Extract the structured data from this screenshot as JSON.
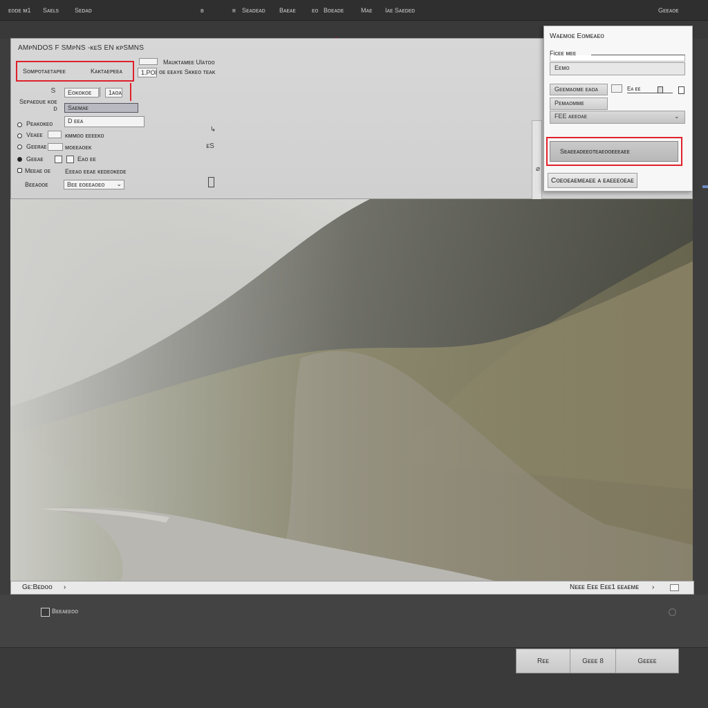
{
  "menubar": {
    "items": [
      "ᴇᴏᴅᴇ ᴍ1",
      "Sᴀᴇʟs",
      "Sᴇᴅᴀᴅ",
      "ʙ",
      "ʀ",
      "Sᴇᴀᴅᴇᴀᴅ",
      "Bᴀᴇᴀᴇ",
      "ᴇᴏ",
      "Bᴏᴇᴀᴅᴇ",
      "Mᴀᴇ",
      "Iᴀᴇ Sᴀᴇᴅᴇᴅ"
    ],
    "right": "Gᴇᴇᴀᴏᴇ"
  },
  "settings": {
    "title": "AMᴘNDOS F SMᴘNS -ᴋᴇS EN ᴋᴘSMNS",
    "top_fields": {
      "left_label": "Sᴏᴍᴘᴏᴛᴀᴇᴛᴀᴘᴇᴇ",
      "left_value": "Kᴀᴋᴛᴀᴇᴘᴇᴇᴀ",
      "small_box": "",
      "small_value": "1.POE",
      "right_label": "Mᴀᴜᴋᴛᴀᴍᴇᴇ Ulᴀᴛᴏᴏ",
      "right_sub": "ᴏᴇ ᴇᴇᴀʏᴇ Sᴋᴋᴇᴏ ᴛᴇᴀᴋ"
    },
    "row_a": {
      "icon": "S",
      "field": "Eᴏᴋᴏᴋᴏᴇ",
      "btn": "1ᴀᴏᴀ"
    },
    "row_b": {
      "label": "Sᴇᴘᴀᴇᴅᴜᴇ ᴋᴏᴇ",
      "icon": "ᴅ",
      "field": "Sᴀᴇᴍᴀᴇ"
    },
    "row_c": {
      "field": "D ᴇᴇᴀ"
    },
    "options": [
      {
        "label": "Pᴇᴀᴋᴏᴋᴇᴏ",
        "value": ""
      },
      {
        "label": "Vᴇᴀᴇᴇ",
        "value": "ᴋᴍᴍᴏᴏ ᴇᴇᴇᴇᴋᴏ"
      },
      {
        "label": "Gᴇᴇʀᴀᴇ",
        "value": "ᴍᴏᴇᴇᴀᴏᴇᴋ"
      },
      {
        "label": "Gᴇᴇᴀᴇ",
        "value": "Eᴀᴏ ᴇᴇ"
      },
      {
        "label": "Mᴇᴇᴀᴇ ᴏᴇ",
        "value": "Eᴇᴇᴀᴏ ᴇᴇᴀᴇ ᴋᴇᴅᴇᴏᴋᴇᴅᴇ"
      }
    ],
    "option_icons": [
      "↳",
      "ᴇS",
      "",
      "▯"
    ],
    "dropdown_label": "Bᴇᴇᴀᴏᴏᴇ",
    "dropdown_value": "Bᴇᴇ ᴇᴏᴇᴇᴀᴏᴇᴏ"
  },
  "dialog": {
    "title": "Wᴀᴇᴍᴏᴇ Eᴏᴍᴇᴀᴇᴏ",
    "name_label": "Ficᴇᴇ ᴍᴇᴇ",
    "field_value": "Eᴇᴍᴏ",
    "slider_label": "Gᴇᴇᴍᴀᴏᴍᴇ ᴇᴀᴏᴀ",
    "slider_value": "Eᴀ  ᴇᴇ",
    "row2": "Pᴇᴍᴀᴏᴍᴍᴇ",
    "row3": "FEE   ᴀᴇᴇᴏᴀᴇ",
    "primary": "Sᴇᴀᴇᴇᴀᴅᴇᴇᴏᴛᴇᴀᴇᴏᴏᴇᴇᴇᴀᴇᴇ",
    "secondary": "Cᴏᴇᴏᴇᴀᴇᴍᴇᴀᴇᴇ ᴀ ᴇᴀᴇᴇᴇᴏᴇᴀᴇ"
  },
  "status": {
    "left": "Gᴇ:Bᴇᴅᴏᴏ",
    "right": "Nᴇᴇᴇ Eᴇᴇ Eᴇᴇ1 ᴇᴇᴀᴇᴍᴇ"
  },
  "footer": {
    "checkbox_label": "Bᴇᴇᴀᴇᴇᴏᴏ",
    "buttons": [
      "Rᴇᴇ",
      "Gᴇᴇᴇ 8",
      "Gᴇᴇᴇᴇ"
    ]
  },
  "colors": {
    "highlight": "#e0202a",
    "panel": "#d3d3d3",
    "dark_ui": "#3d3d3d"
  }
}
